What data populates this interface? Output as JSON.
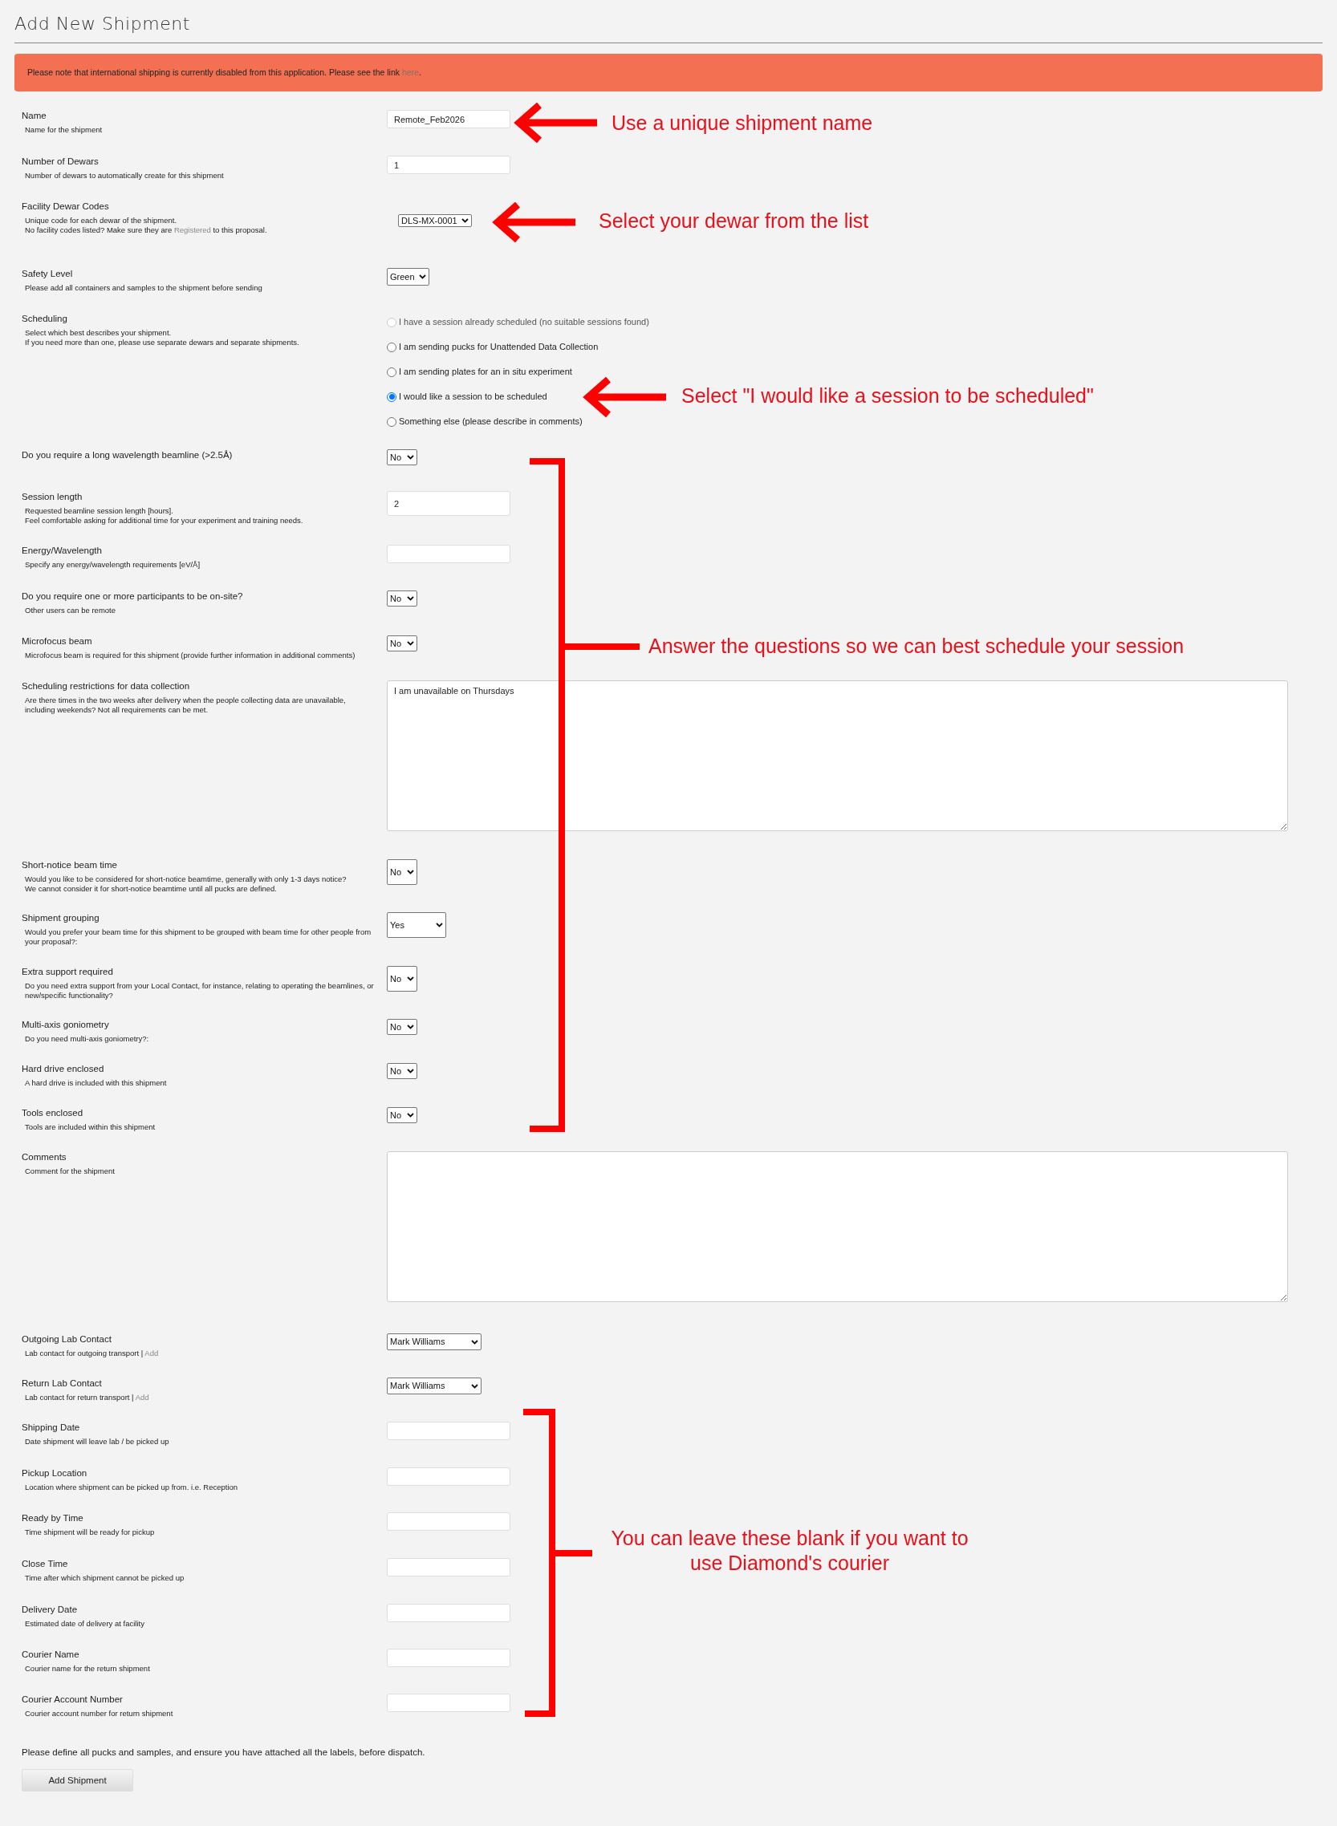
{
  "page_title": "Add New Shipment",
  "alert": {
    "text": "Please note that international shipping is currently disabled from this application. Please see the link ",
    "link": "here",
    "after": "."
  },
  "fields": [
    {
      "kind": "text",
      "label": "Name",
      "description": [
        "Name for the shipment"
      ],
      "value": "Remote_Feb2026"
    },
    {
      "kind": "text",
      "label": "Number of Dewars",
      "description": [
        "Number of dewars to automatically create for this shipment"
      ],
      "value": "1"
    },
    {
      "kind": "select",
      "label": "Facility Dewar Codes",
      "description": [
        "Unique code for each dewar of the shipment.",
        [
          {
            "text": "No facility codes listed? Make sure they are "
          },
          {
            "text": "Registered",
            "link": true
          },
          {
            "text": " to this proposal."
          }
        ]
      ],
      "value": "DLS-MX-0001"
    },
    {
      "kind": "select",
      "label": "Safety Level",
      "description": [
        "Please add all containers and samples to the shipment before sending"
      ],
      "value": "Green"
    },
    {
      "kind": "radio",
      "label": "Scheduling",
      "description": [
        "Select which best describes your shipment.",
        "If you need more than one, please use separate dewars and separate shipments."
      ],
      "options": [
        {
          "label": "I have a session already scheduled (no suitable sessions found)",
          "selected": false,
          "disabled": true
        },
        {
          "label": "I am sending pucks for Unattended Data Collection",
          "selected": false,
          "disabled": false
        },
        {
          "label": "I am sending plates for an in situ experiment",
          "selected": false,
          "disabled": false
        },
        {
          "label": "I would like a session to be scheduled",
          "selected": true,
          "disabled": false
        },
        {
          "label": "Something else (please describe in comments)",
          "selected": false,
          "disabled": false
        }
      ]
    },
    {
      "kind": "select",
      "label": "Do you require a long wavelength beamline (>2.5Å)",
      "value": "No"
    },
    {
      "kind": "text",
      "label": "Session length",
      "description": [
        "Requested beamline session length [hours].",
        "Feel comfortable asking for additional time for your experiment and training needs."
      ],
      "value": "2"
    },
    {
      "kind": "text",
      "label": "Energy/Wavelength",
      "description": [
        "Specify any energy/wavelength requirements [eV/Å]"
      ]
    },
    {
      "kind": "select",
      "label": "Do you require one or more participants to be on-site?",
      "description": [
        "Other users can be remote"
      ],
      "value": "No"
    },
    {
      "kind": "select",
      "label": "Microfocus beam",
      "description": [
        "Microfocus beam is required for this shipment (provide further information in additional comments)"
      ],
      "value": "No"
    },
    {
      "kind": "textarea",
      "label": "Scheduling restrictions for data collection",
      "description": [
        "Are there times in the two weeks after delivery when the people collecting data are unavailable, including weekends? Not all requirements can be met."
      ],
      "value": "I am unavailable on Thursdays"
    },
    {
      "kind": "select",
      "label": "Short-notice beam time",
      "description": [
        "Would you like to be considered for short-notice beamtime, generally with only 1-3 days notice?",
        "We cannot consider it for short-notice beamtime until all pucks are defined."
      ],
      "value": "No"
    },
    {
      "kind": "select",
      "label": "Shipment grouping",
      "description": [
        "Would you prefer your beam time for this shipment to be grouped with beam time for other people from your proposal?:"
      ],
      "value": "Yes"
    },
    {
      "kind": "select",
      "label": "Extra support required",
      "description": [
        "Do you need extra support from your Local Contact, for instance, relating to operating the beamlines, or new/specific functionality?"
      ],
      "value": "No"
    },
    {
      "kind": "select",
      "label": "Multi-axis goniometry",
      "description": [
        "Do you need multi-axis goniometry?:"
      ],
      "value": "No"
    },
    {
      "kind": "select",
      "label": "Hard drive enclosed",
      "description": [
        "A hard drive is included with this shipment"
      ],
      "value": "No"
    },
    {
      "kind": "select",
      "label": "Tools enclosed",
      "description": [
        "Tools are included within this shipment"
      ],
      "value": "No"
    },
    {
      "kind": "textarea",
      "label": "Comments",
      "description": [
        "Comment for the shipment"
      ]
    },
    {
      "kind": "select",
      "label": "Outgoing Lab Contact",
      "description": [
        [
          {
            "text": "Lab contact for outgoing transport | "
          },
          {
            "text": "Add",
            "link": true
          }
        ]
      ],
      "value": "Mark Williams"
    },
    {
      "kind": "select",
      "label": "Return Lab Contact",
      "description": [
        [
          {
            "text": "Lab contact for return transport | "
          },
          {
            "text": "Add",
            "link": true
          }
        ]
      ],
      "value": "Mark Williams"
    },
    {
      "kind": "text",
      "label": "Shipping Date",
      "description": [
        "Date shipment will leave lab / be picked up"
      ]
    },
    {
      "kind": "text",
      "label": "Pickup Location",
      "description": [
        "Location where shipment can be picked up from. i.e. Reception"
      ]
    },
    {
      "kind": "text",
      "label": "Ready by Time",
      "description": [
        "Time shipment will be ready for pickup"
      ]
    },
    {
      "kind": "text",
      "label": "Close Time",
      "description": [
        "Time after which shipment cannot be picked up"
      ]
    },
    {
      "kind": "text",
      "label": "Delivery Date",
      "description": [
        "Estimated date of delivery at facility"
      ]
    },
    {
      "kind": "text",
      "label": "Courier Name",
      "description": [
        "Courier name for the return shipment"
      ]
    },
    {
      "kind": "text",
      "label": "Courier Account Number",
      "description": [
        "Courier account number for return shipment"
      ]
    }
  ],
  "note": "Please define all pucks and samples, and ensure you have attached all the labels, before dispatch.",
  "submit_button": "Add Shipment",
  "annotations": [
    {
      "kind": "arrow",
      "text": "Use a unique shipment name"
    },
    {
      "kind": "arrow",
      "text": "Select your dewar from the list"
    },
    {
      "kind": "arrow",
      "text": "Select \"I would like a session to be scheduled\""
    },
    {
      "kind": "bracket",
      "text": "Answer the questions so we can best schedule your session"
    },
    {
      "kind": "bracket",
      "text": "You can leave these blank if you want to use Diamond's courier"
    }
  ]
}
